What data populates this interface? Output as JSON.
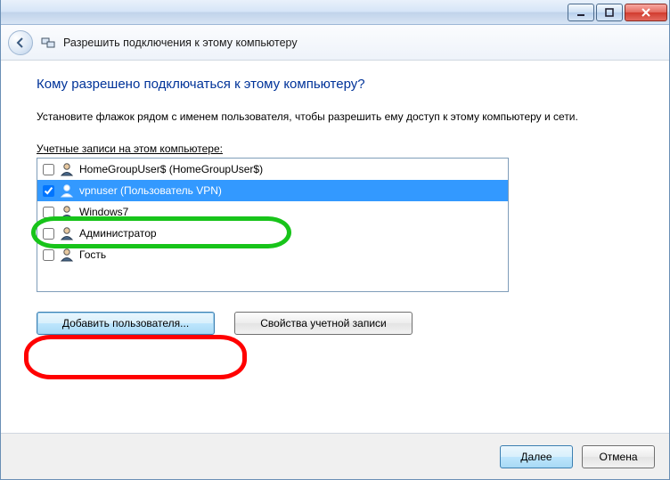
{
  "titlebar": {
    "minimize_tooltip": "Свернуть",
    "maximize_tooltip": "Развернуть",
    "close_tooltip": "Закрыть"
  },
  "wizard": {
    "title": "Разрешить подключения к этому компьютеру"
  },
  "page": {
    "heading": "Кому разрешено подключаться к этому компьютеру?",
    "instruction": "Установите флажок рядом с именем пользователя, чтобы разрешить ему доступ к этому компьютеру и сети.",
    "list_label_text": "Учетные записи на этом компьютере:",
    "list_label_accel": "У"
  },
  "users": [
    {
      "checked": false,
      "label": "HomeGroupUser$ (HomeGroupUser$)",
      "selected": false
    },
    {
      "checked": true,
      "label": "vpnuser (Пользователь VPN)",
      "selected": true
    },
    {
      "checked": false,
      "label": "Windows7",
      "selected": false
    },
    {
      "checked": false,
      "label": "Администратор",
      "selected": false
    },
    {
      "checked": false,
      "label": "Гость",
      "selected": false
    }
  ],
  "buttons": {
    "add_user": "Добавить пользователя...",
    "props": "Свойства учетной записи",
    "next": "Далее",
    "cancel": "Отмена"
  }
}
